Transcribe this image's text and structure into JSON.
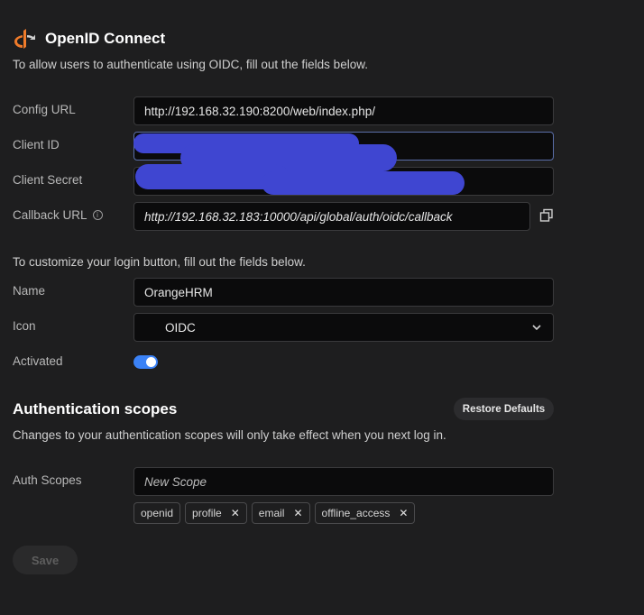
{
  "header": {
    "title": "OpenID Connect",
    "intro": "To allow users to authenticate using OIDC, fill out the fields below."
  },
  "fields": {
    "config_url": {
      "label": "Config URL",
      "value": "http://192.168.32.190:8200/web/index.php/"
    },
    "client_id": {
      "label": "Client ID",
      "value": ""
    },
    "client_secret": {
      "label": "Client Secret",
      "value": ""
    },
    "callback_url": {
      "label": "Callback URL",
      "value": "http://192.168.32.183:10000/api/global/auth/oidc/callback"
    }
  },
  "customize": {
    "note": "To customize your login button, fill out the fields below.",
    "name": {
      "label": "Name",
      "value": "OrangeHRM"
    },
    "icon": {
      "label": "Icon",
      "value": "OIDC"
    },
    "activated": {
      "label": "Activated",
      "on": true
    }
  },
  "scopes": {
    "heading": "Authentication scopes",
    "restore_label": "Restore Defaults",
    "note": "Changes to your authentication scopes will only take effect when you next log in.",
    "label": "Auth Scopes",
    "placeholder": "New Scope",
    "items": [
      {
        "name": "openid",
        "removable": false
      },
      {
        "name": "profile",
        "removable": true
      },
      {
        "name": "email",
        "removable": true
      },
      {
        "name": "offline_access",
        "removable": true
      }
    ]
  },
  "actions": {
    "save_label": "Save"
  },
  "colors": {
    "accent": "#3b82f6",
    "redaction": "#3f46d1",
    "logo": "#f07b2a"
  }
}
